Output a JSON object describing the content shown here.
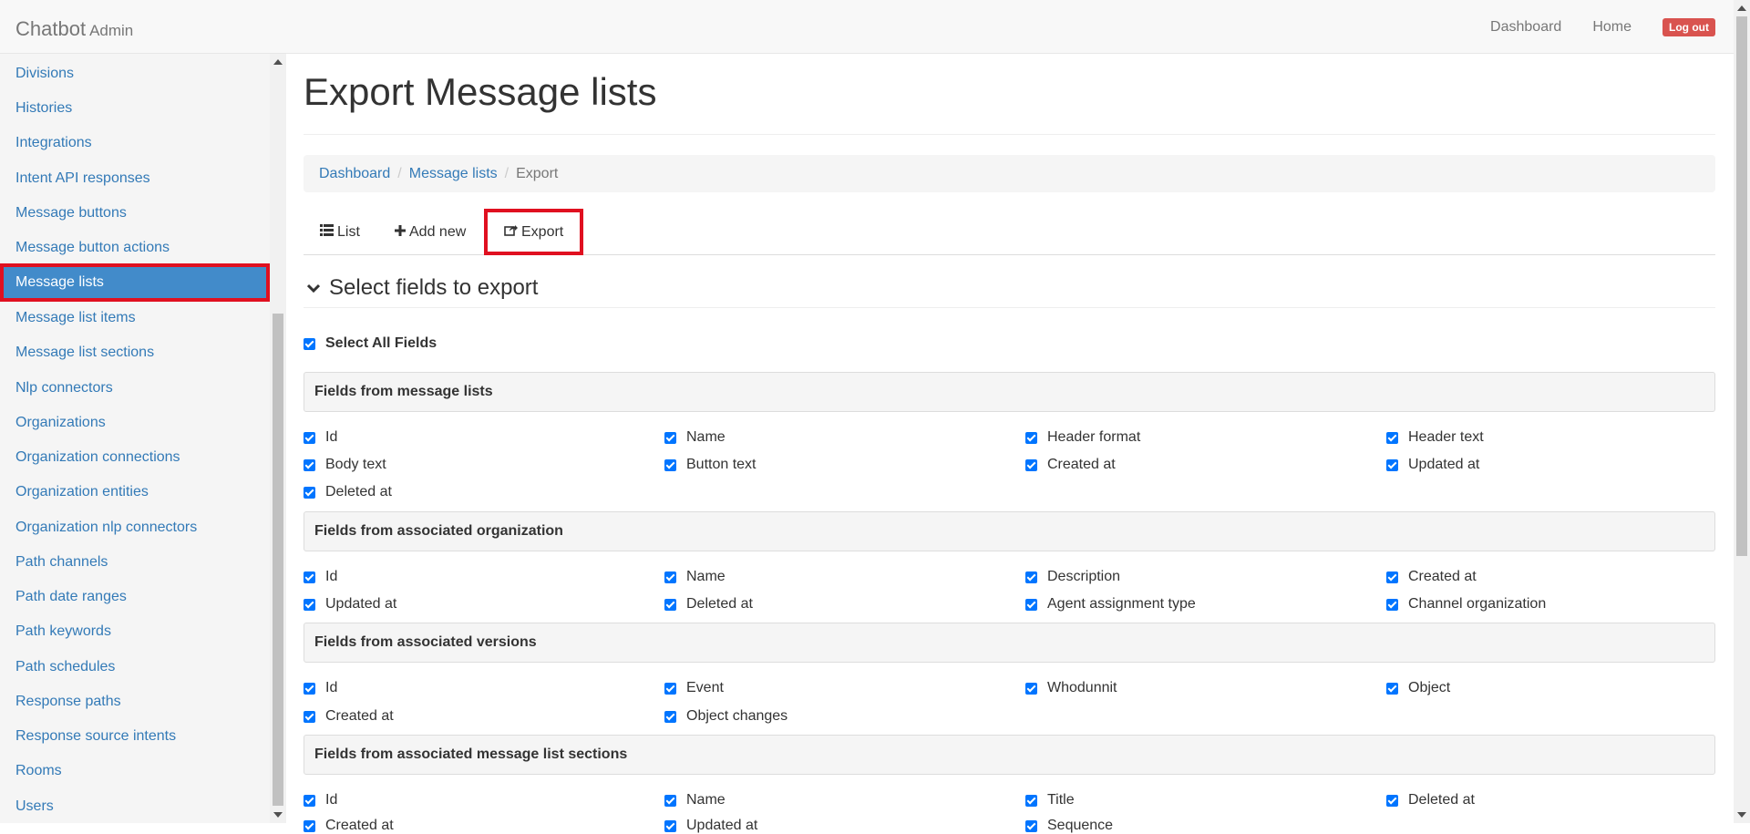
{
  "navbar": {
    "brand": "Chatbot",
    "brand_sub": "Admin",
    "links": [
      "Dashboard",
      "Home"
    ],
    "logout": "Log out"
  },
  "sidebar": {
    "items": [
      "Divisions",
      "Histories",
      "Integrations",
      "Intent API responses",
      "Message buttons",
      "Message button actions",
      "Message lists",
      "Message list items",
      "Message list sections",
      "Nlp connectors",
      "Organizations",
      "Organization connections",
      "Organization entities",
      "Organization nlp connectors",
      "Path channels",
      "Path date ranges",
      "Path keywords",
      "Path schedules",
      "Response paths",
      "Response source intents",
      "Rooms",
      "Users"
    ],
    "active": "Message lists"
  },
  "page": {
    "title": "Export Message lists"
  },
  "breadcrumb": {
    "items": [
      "Dashboard",
      "Message lists"
    ],
    "current": "Export"
  },
  "tabs": {
    "list": "List",
    "add_new": "Add new",
    "export": "Export"
  },
  "section": {
    "title": "Select fields to export"
  },
  "select_all": {
    "label": "Select All Fields",
    "checked": true
  },
  "groups": [
    {
      "title": "Fields from message lists",
      "fields": [
        "Id",
        "Name",
        "Header format",
        "Header text",
        "Body text",
        "Button text",
        "Created at",
        "Updated at",
        "Deleted at"
      ]
    },
    {
      "title": "Fields from associated organization",
      "fields": [
        "Id",
        "Name",
        "Description",
        "Created at",
        "Updated at",
        "Deleted at",
        "Agent assignment type",
        "Channel organization"
      ]
    },
    {
      "title": "Fields from associated versions",
      "fields": [
        "Id",
        "Event",
        "Whodunnit",
        "Object",
        "Created at",
        "Object changes"
      ]
    },
    {
      "title": "Fields from associated message list sections",
      "fields": [
        "Id",
        "Name",
        "Title",
        "Deleted at",
        "Created at",
        "Updated at",
        "Sequence"
      ]
    }
  ],
  "colors": {
    "link": "#337ab7",
    "active_bg": "#428bca",
    "highlight": "#e01020",
    "logout": "#d9534f",
    "checkbox": "#0075ff"
  }
}
